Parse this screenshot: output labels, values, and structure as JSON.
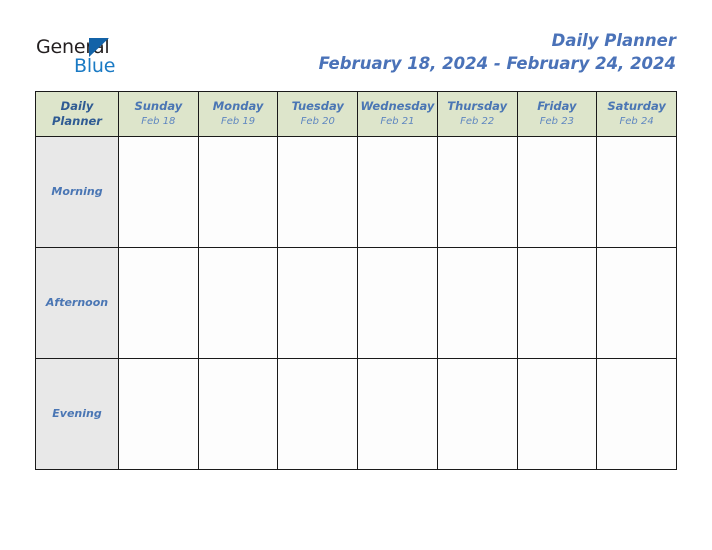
{
  "brand": {
    "word_one": "General",
    "word_two": "Blue",
    "triangle_icon": "triangle-logo-icon",
    "blue_hex": "#1a7ac4",
    "dark_hex": "#231f20"
  },
  "header": {
    "title": "Daily Planner",
    "date_range": "February 18, 2024 - February 24, 2024",
    "title_color": "#4a72b8"
  },
  "table": {
    "corner": {
      "line1": "Daily",
      "line2": "Planner"
    },
    "header_bg": "#dde5cb",
    "period_bg": "#e8e8e8",
    "cell_bg": "#fdfdfd",
    "border_color": "#1a1a1a",
    "days": [
      {
        "name": "Sunday",
        "date": "Feb 18"
      },
      {
        "name": "Monday",
        "date": "Feb 19"
      },
      {
        "name": "Tuesday",
        "date": "Feb 20"
      },
      {
        "name": "Wednesday",
        "date": "Feb 21"
      },
      {
        "name": "Thursday",
        "date": "Feb 22"
      },
      {
        "name": "Friday",
        "date": "Feb 23"
      },
      {
        "name": "Saturday",
        "date": "Feb 24"
      }
    ],
    "periods": [
      {
        "label": "Morning",
        "entries": [
          "",
          "",
          "",
          "",
          "",
          "",
          ""
        ]
      },
      {
        "label": "Afternoon",
        "entries": [
          "",
          "",
          "",
          "",
          "",
          "",
          ""
        ]
      },
      {
        "label": "Evening",
        "entries": [
          "",
          "",
          "",
          "",
          "",
          "",
          ""
        ]
      }
    ]
  }
}
